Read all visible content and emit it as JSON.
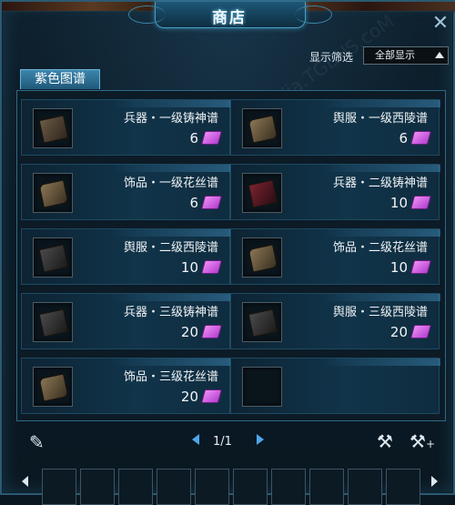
{
  "window": {
    "title": "商店",
    "close_icon": "close-icon"
  },
  "filter": {
    "label": "显示筛选",
    "selected": "全部显示"
  },
  "tab": {
    "label": "紫色图谱"
  },
  "items": [
    {
      "name": "兵器・一级铸神谱",
      "price": "6",
      "icon": "weapon-recipe-icon"
    },
    {
      "name": "舆服・一级西陵谱",
      "price": "6",
      "icon": "armor-recipe-icon"
    },
    {
      "name": "饰品・一级花丝谱",
      "price": "6",
      "icon": "accessory-recipe-icon"
    },
    {
      "name": "兵器・二级铸神谱",
      "price": "10",
      "icon": "weapon-recipe-icon"
    },
    {
      "name": "舆服・二级西陵谱",
      "price": "10",
      "icon": "armor-recipe-icon"
    },
    {
      "name": "饰品・二级花丝谱",
      "price": "10",
      "icon": "accessory-recipe-icon"
    },
    {
      "name": "兵器・三级铸神谱",
      "price": "20",
      "icon": "weapon-recipe-icon"
    },
    {
      "name": "舆服・三级西陵谱",
      "price": "20",
      "icon": "armor-recipe-icon"
    },
    {
      "name": "饰品・三级花丝谱",
      "price": "20",
      "icon": "accessory-recipe-icon"
    }
  ],
  "currency_icon": "purple-ticket-icon",
  "pager": {
    "text": "1/1"
  },
  "toolbar": {
    "left_icon": "sell-icon",
    "repair_icon": "hammer-icon",
    "repair_all_icon": "hammer-plus-icon"
  }
}
